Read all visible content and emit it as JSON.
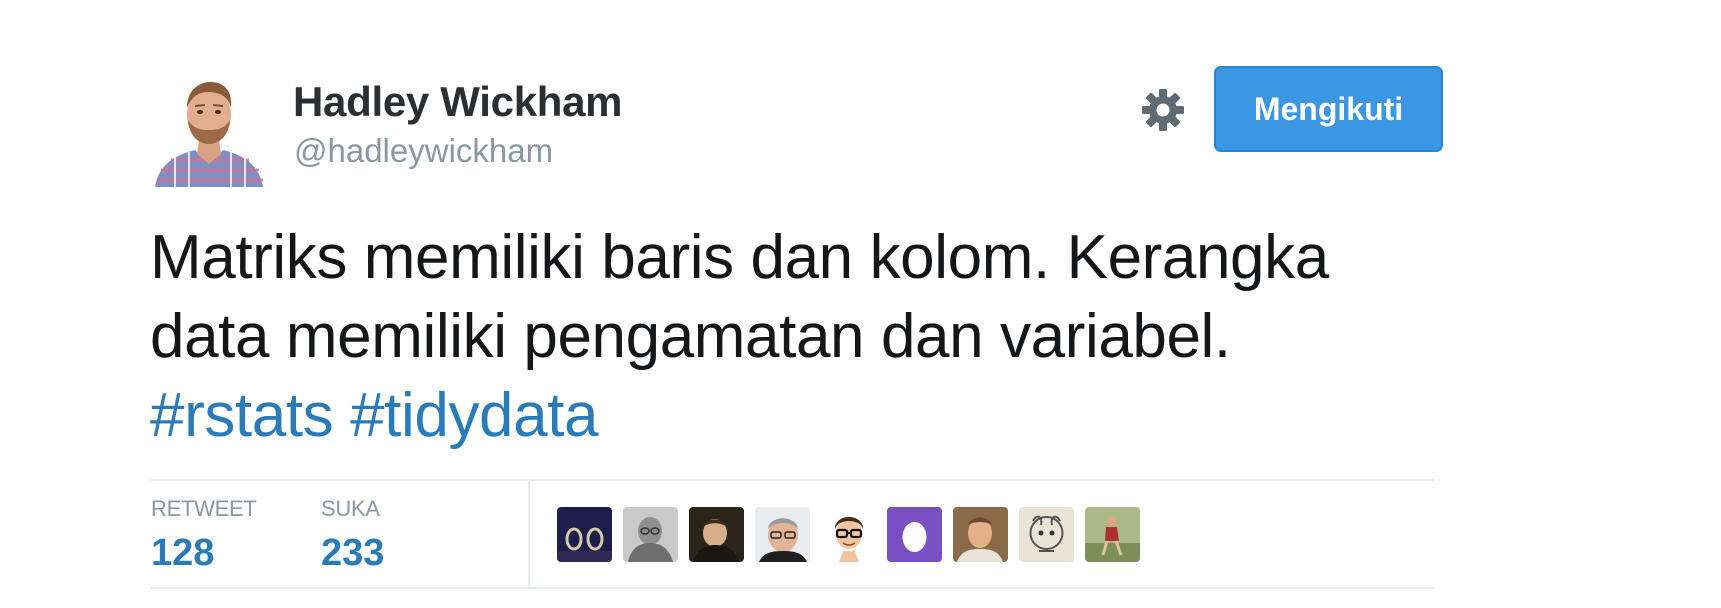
{
  "author": {
    "name": "Hadley Wickham",
    "handle": "@hadleywickham",
    "avatar_icon": "profile-photo-icon"
  },
  "actions": {
    "settings_icon": "gear-icon",
    "follow_label": "Mengikuti",
    "follow_color": "#3b97e3"
  },
  "tweet": {
    "line1": "Matriks memiliki baris dan kolom. Kerangka",
    "line2": "data memiliki pengamatan dan variabel.",
    "hashtags": [
      "#rstats",
      "#tidydata"
    ],
    "hashtag_color": "#2b7bb9"
  },
  "stats": {
    "retweet_label": "RETWEET",
    "retweet_count": "128",
    "like_label": "SUKA",
    "like_count": "233"
  },
  "likers": [
    {
      "icon": "liker-avatar-1-icon"
    },
    {
      "icon": "liker-avatar-2-icon"
    },
    {
      "icon": "liker-avatar-3-icon"
    },
    {
      "icon": "liker-avatar-4-icon"
    },
    {
      "icon": "liker-avatar-5-icon"
    },
    {
      "icon": "liker-avatar-egg-icon"
    },
    {
      "icon": "liker-avatar-7-icon"
    },
    {
      "icon": "liker-avatar-8-icon"
    },
    {
      "icon": "liker-avatar-9-icon"
    }
  ]
}
